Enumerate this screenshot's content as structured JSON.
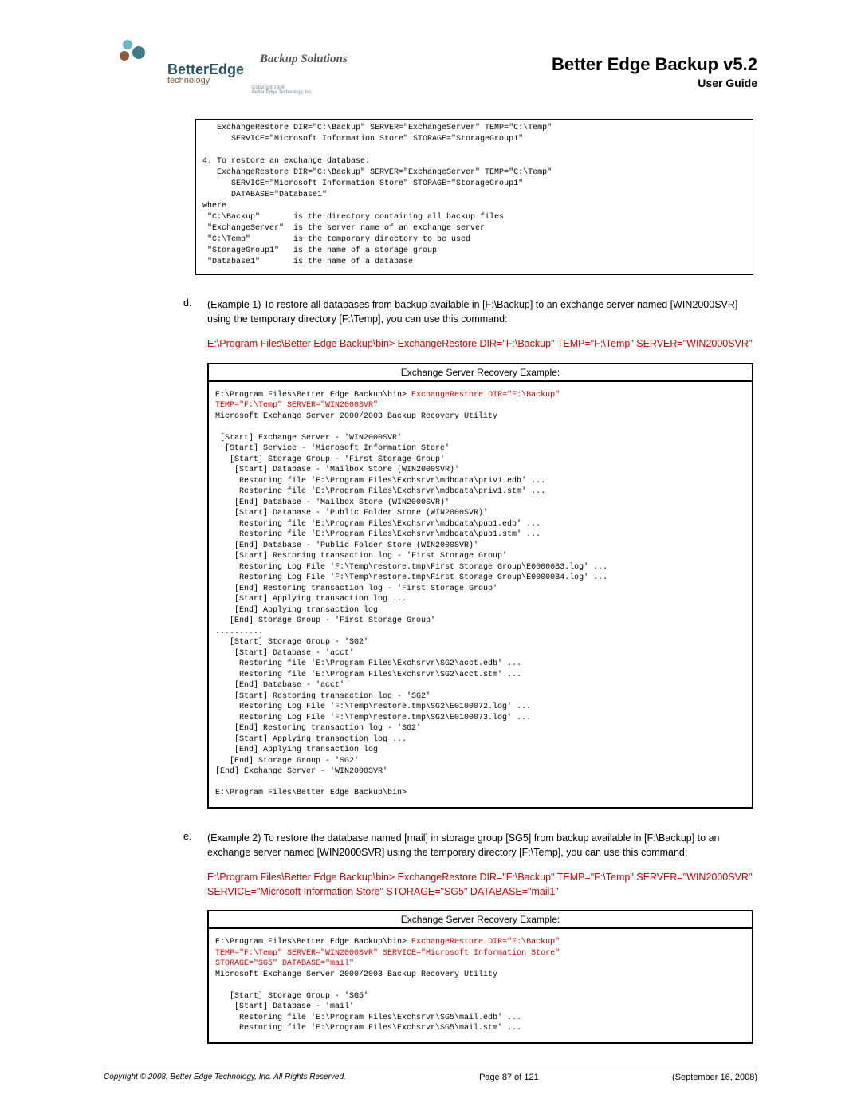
{
  "header": {
    "logoName": "BetterEdge",
    "logoSub": "technology",
    "backupSolutions": "Backup Solutions",
    "tinyCopy": "Copyright 2008\nBetter Edge Technology, Inc.",
    "docTitle": "Better Edge Backup v5.2",
    "docSub": "User Guide"
  },
  "codeBox1": "   ExchangeRestore DIR=\"C:\\Backup\" SERVER=\"ExchangeServer\" TEMP=\"C:\\Temp\"\n      SERVICE=\"Microsoft Information Store\" STORAGE=\"StorageGroup1\"\n\n4. To restore an exchange database:\n   ExchangeRestore DIR=\"C:\\Backup\" SERVER=\"ExchangeServer\" TEMP=\"C:\\Temp\"\n      SERVICE=\"Microsoft Information Store\" STORAGE=\"StorageGroup1\"\n      DATABASE=\"Database1\"\nwhere\n \"C:\\Backup\"       is the directory containing all backup files\n \"ExchangeServer\"  is the server name of an exchange server\n \"C:\\Temp\"         is the temporary directory to be used\n \"StorageGroup1\"   is the name of a storage group\n \"Database1\"       is the name of a database",
  "itemD": {
    "letter": "d.",
    "text": "(Example 1) To restore all databases from backup available in [F:\\Backup] to an exchange server named [WIN2000SVR] using the temporary directory [F:\\Temp], you can use this command:",
    "command": "E:\\Program Files\\Better Edge Backup\\bin> ExchangeRestore DIR=\"F:\\Backup\" TEMP=\"F:\\Temp\" SERVER=\"WIN2000SVR\""
  },
  "example1": {
    "title": "Exchange Server Recovery Example:",
    "prompt": "E:\\Program Files\\Better Edge Backup\\bin> ",
    "redCmd": "ExchangeRestore DIR=\"F:\\Backup\"\nTEMP=\"F:\\Temp\" SERVER=\"WIN2000SVR\"",
    "body": "\nMicrosoft Exchange Server 2000/2003 Backup Recovery Utility\n\n [Start] Exchange Server - 'WIN2000SVR'\n  [Start] Service - 'Microsoft Information Store'\n   [Start] Storage Group - 'First Storage Group'\n    [Start] Database - 'Mailbox Store (WIN2000SVR)'\n     Restoring file 'E:\\Program Files\\Exchsrvr\\mdbdata\\priv1.edb' ...\n     Restoring file 'E:\\Program Files\\Exchsrvr\\mdbdata\\priv1.stm' ...\n    [End] Database - 'Mailbox Store (WIN2000SVR)'\n    [Start] Database - 'Public Folder Store (WIN2000SVR)'\n     Restoring file 'E:\\Program Files\\Exchsrvr\\mdbdata\\pub1.edb' ...\n     Restoring file 'E:\\Program Files\\Exchsrvr\\mdbdata\\pub1.stm' ...\n    [End] Database - 'Public Folder Store (WIN2000SVR)'\n    [Start] Restoring transaction log - 'First Storage Group'\n     Restoring Log File 'F:\\Temp\\restore.tmp\\First Storage Group\\E00000B3.log' ...\n     Restoring Log File 'F:\\Temp\\restore.tmp\\First Storage Group\\E00000B4.log' ...\n    [End] Restoring transaction log - 'First Storage Group'\n    [Start] Applying transaction log ...\n    [End] Applying transaction log\n   [End] Storage Group - 'First Storage Group'\n..........\n   [Start] Storage Group - 'SG2'\n    [Start] Database - 'acct'\n     Restoring file 'E:\\Program Files\\Exchsrvr\\SG2\\acct.edb' ...\n     Restoring file 'E:\\Program Files\\Exchsrvr\\SG2\\acct.stm' ...\n    [End] Database - 'acct'\n    [Start] Restoring transaction log - 'SG2'\n     Restoring Log File 'F:\\Temp\\restore.tmp\\SG2\\E0100072.log' ...\n     Restoring Log File 'F:\\Temp\\restore.tmp\\SG2\\E0100073.log' ...\n    [End] Restoring transaction log - 'SG2'\n    [Start] Applying transaction log ...\n    [End] Applying transaction log\n   [End] Storage Group - 'SG2'\n[End] Exchange Server - 'WIN2000SVR'\n\nE:\\Program Files\\Better Edge Backup\\bin>"
  },
  "itemE": {
    "letter": "e.",
    "text": "(Example 2) To restore the database named [mail] in storage group [SG5] from backup available in [F:\\Backup] to an exchange server named [WIN2000SVR] using the temporary directory [F:\\Temp], you can use this command:",
    "command": "E:\\Program Files\\Better Edge Backup\\bin> ExchangeRestore DIR=\"F:\\Backup\" TEMP=\"F:\\Temp\" SERVER=\"WIN2000SVR\" SERVICE=\"Microsoft Information Store\" STORAGE=\"SG5\" DATABASE=\"mail1\""
  },
  "example2": {
    "title": "Exchange Server Recovery Example:",
    "prompt": "E:\\Program Files\\Better Edge Backup\\bin> ",
    "redCmd": "ExchangeRestore DIR=\"F:\\Backup\"\nTEMP=\"F:\\Temp\" SERVER=\"WIN2000SVR\" SERVICE=\"Microsoft Information Store\"\nSTORAGE=\"SG5\" DATABASE=\"mail\"",
    "body": "\nMicrosoft Exchange Server 2000/2003 Backup Recovery Utility\n\n   [Start] Storage Group - 'SG5'\n    [Start] Database - 'mail'\n     Restoring file 'E:\\Program Files\\Exchsrvr\\SG5\\mail.edb' ...\n     Restoring file 'E:\\Program Files\\Exchsrvr\\SG5\\mail.stm' ..."
  },
  "footer": {
    "copyright": "Copyright © 2008, Better Edge Technology, Inc.   All Rights Reserved.",
    "page": "Page 87 of 121",
    "date": "(September 16, 2008)"
  }
}
